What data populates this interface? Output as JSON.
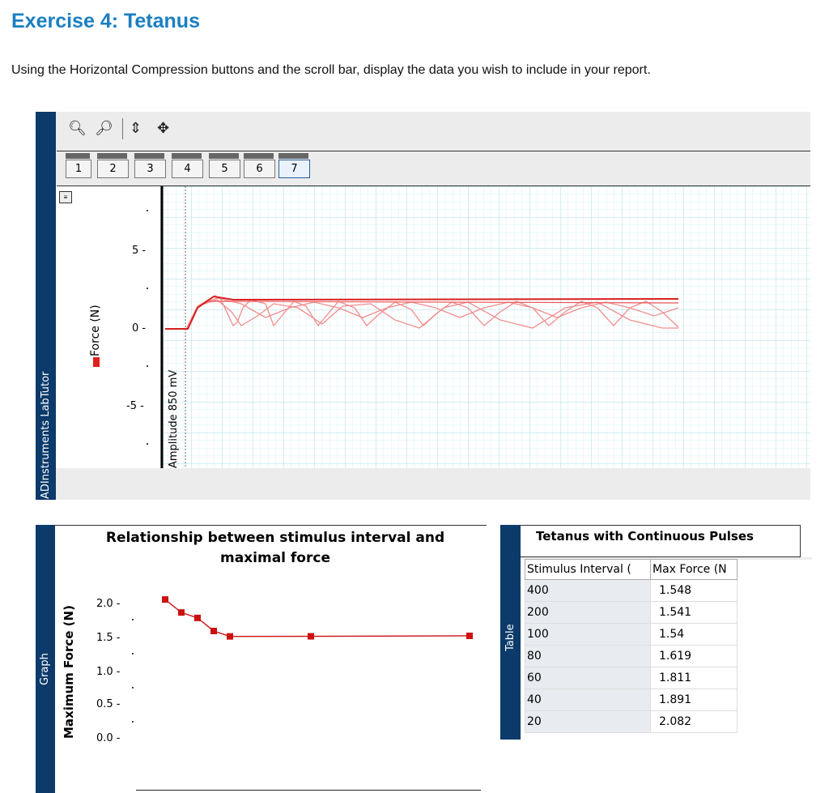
{
  "doc": {
    "title": "Exercise 4: Tetanus",
    "instructions": "Using the Horizontal Compression buttons and the scroll bar, display the data you wish to include in your report."
  },
  "labtutor_panel": {
    "sidebar_label": "ADInstruments LabTutor",
    "toolbar_icons": [
      "zoom-in-icon",
      "zoom-out-icon",
      "autoscale-icon",
      "pan-icon"
    ],
    "tabs": [
      "1",
      "2",
      "3",
      "4",
      "5",
      "6",
      "7"
    ],
    "active_tab_index": 6,
    "channel_label": "Force (N)",
    "channel_color": "#e02020",
    "y_ticks": [
      "5 -",
      "0 -",
      "-5 -"
    ],
    "marker_label": "Amplitude 850 mV"
  },
  "graph_panel": {
    "sidebar_label": "Graph",
    "title_line1": "Relationship between stimulus interval and",
    "title_line2": "maximal force",
    "ylabel": "Maximum Force (N)",
    "y_ticks": [
      "2.0 -",
      "1.5 -",
      "1.0 -",
      "0.5 -",
      "0.0 -"
    ]
  },
  "table_panel": {
    "sidebar_label": "Table",
    "title": "Tetanus with Continuous Pulses",
    "columns": [
      "Stimulus Interval (",
      "Max Force (N"
    ],
    "rows": [
      [
        "400",
        "1.548"
      ],
      [
        "200",
        "1.541"
      ],
      [
        "100",
        "1.54"
      ],
      [
        "80",
        "1.619"
      ],
      [
        "60",
        "1.811"
      ],
      [
        "40",
        "1.891"
      ],
      [
        "20",
        "2.082"
      ]
    ]
  },
  "chart_data": {
    "type": "line",
    "title": "Relationship between stimulus interval and maximal force",
    "xlabel": "",
    "ylabel": "Maximum Force (N)",
    "ylim": [
      0,
      2.2
    ],
    "color": "#cc1111",
    "series": [
      {
        "values": [
          2.082,
          1.891,
          1.811,
          1.619,
          1.54,
          1.541,
          1.548
        ]
      }
    ],
    "point_order": "stimulus interval 20, 40, 60, 80, 100, 200, 400"
  }
}
